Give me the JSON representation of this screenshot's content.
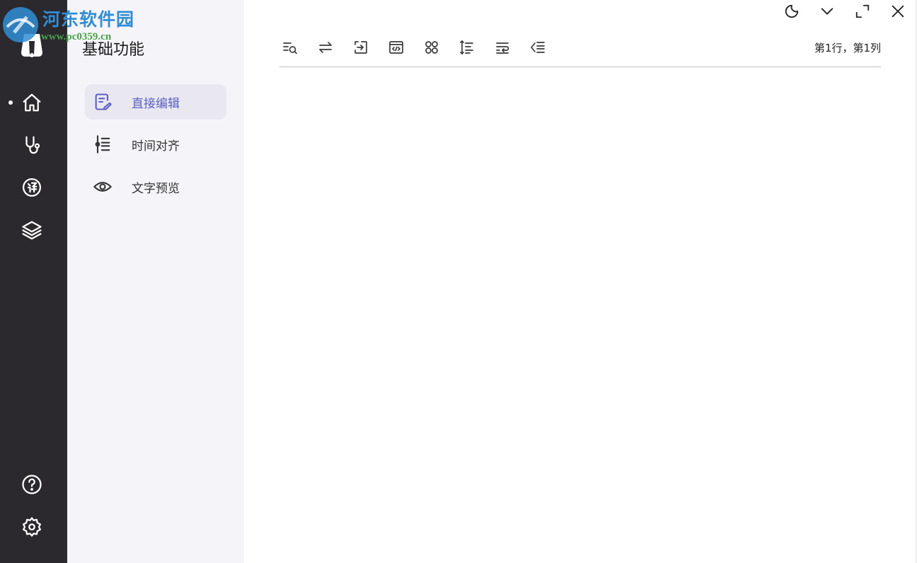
{
  "watermark": {
    "title": "河东软件园",
    "url": "www.pc0359.cn"
  },
  "colors": {
    "rail_bg": "#2b292d",
    "sidebar_bg": "#f5f4f8",
    "accent": "#5b5fc7"
  },
  "rail": {
    "top_items": [
      "home-icon",
      "stethoscope-icon",
      "translate-icon",
      "layers-icon"
    ],
    "bottom_items": [
      "help-icon",
      "settings-icon"
    ]
  },
  "sidebar": {
    "title": "基础功能",
    "items": [
      {
        "label": "直接编辑",
        "icon": "edit-icon",
        "active": true
      },
      {
        "label": "时间对齐",
        "icon": "timeline-icon",
        "active": false
      },
      {
        "label": "文字预览",
        "icon": "eye-icon",
        "active": false
      }
    ]
  },
  "window_controls": [
    "theme-moon-icon",
    "chevron-down-icon",
    "maximize-icon",
    "close-icon"
  ],
  "toolbar": {
    "tools": [
      "find-icon",
      "swap-icon",
      "insert-icon",
      "code-icon",
      "grid-icon",
      "align-time-icon",
      "wrap-icon",
      "outdent-icon"
    ],
    "cursor_position": "第1行，第1列"
  }
}
